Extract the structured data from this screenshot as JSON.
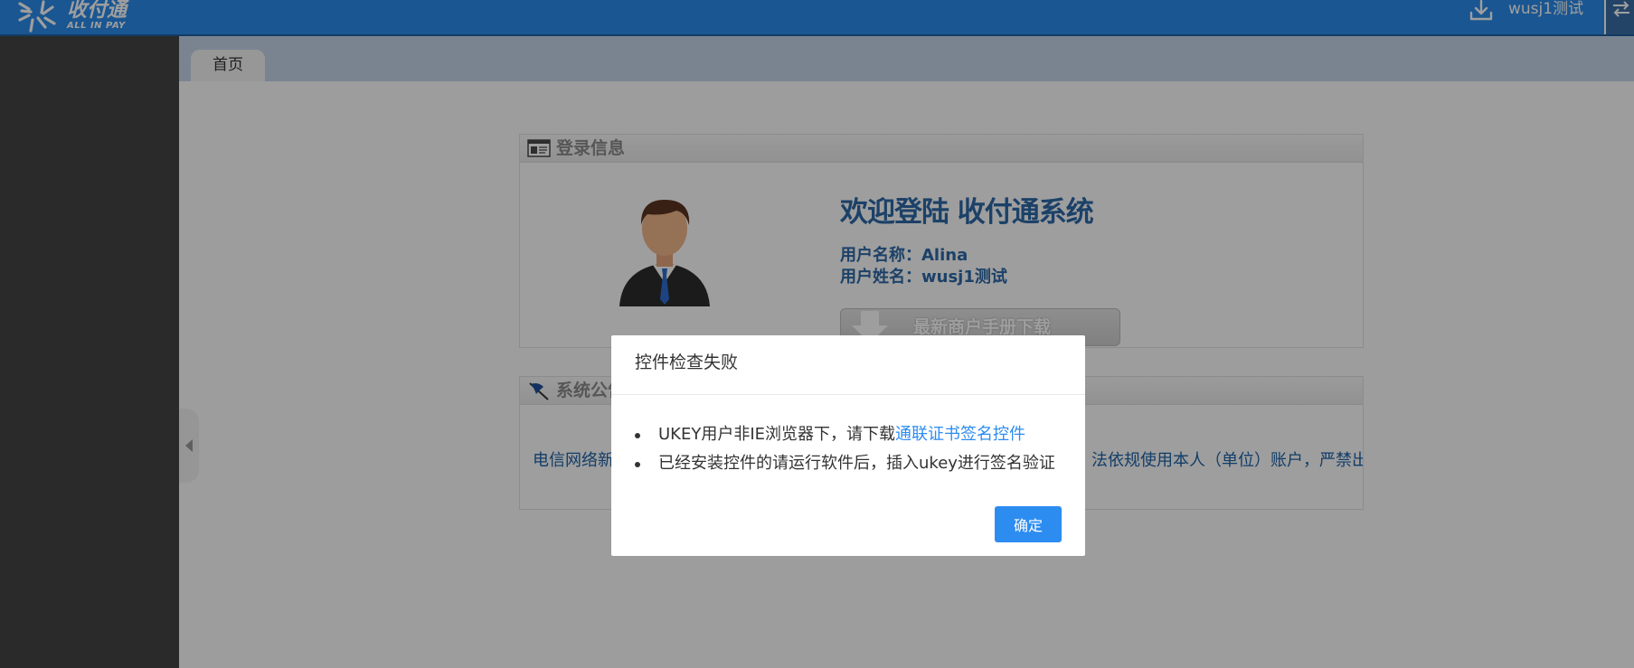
{
  "header": {
    "logo_cn": "收付通",
    "logo_en": "ALL IN PAY",
    "user_name": "wusj1测试",
    "download_icon": "download-icon",
    "exit_icon": "exit-icon"
  },
  "tabs": [
    {
      "label": "首页"
    }
  ],
  "login_panel": {
    "title": "登录信息",
    "welcome": "欢迎登陆  收付通系统",
    "username_label": "用户名称：",
    "username_value": "Alina",
    "realname_label": "用户姓名：",
    "realname_value": "wusj1测试",
    "manual_button": "最新商户手册下载"
  },
  "notice_panel": {
    "title": "系统公告",
    "text_left": "电信网络新",
    "text_right": "法依规使用本人（单位）账户，严禁出"
  },
  "dialog": {
    "title": "控件检查失败",
    "line1_prefix": "UKEY用户非IE浏览器下，请下载",
    "line1_link": "通联证书签名控件",
    "line2": "已经安装控件的请运行软件后，插入ukey进行签名验证",
    "ok_button": "确定"
  },
  "colors": {
    "topbar": "#2a8bea",
    "sidebar": "#444444",
    "link": "#2d8cf0",
    "primary_button": "#2d8cf0",
    "panel_text": "#2e6aa8"
  }
}
